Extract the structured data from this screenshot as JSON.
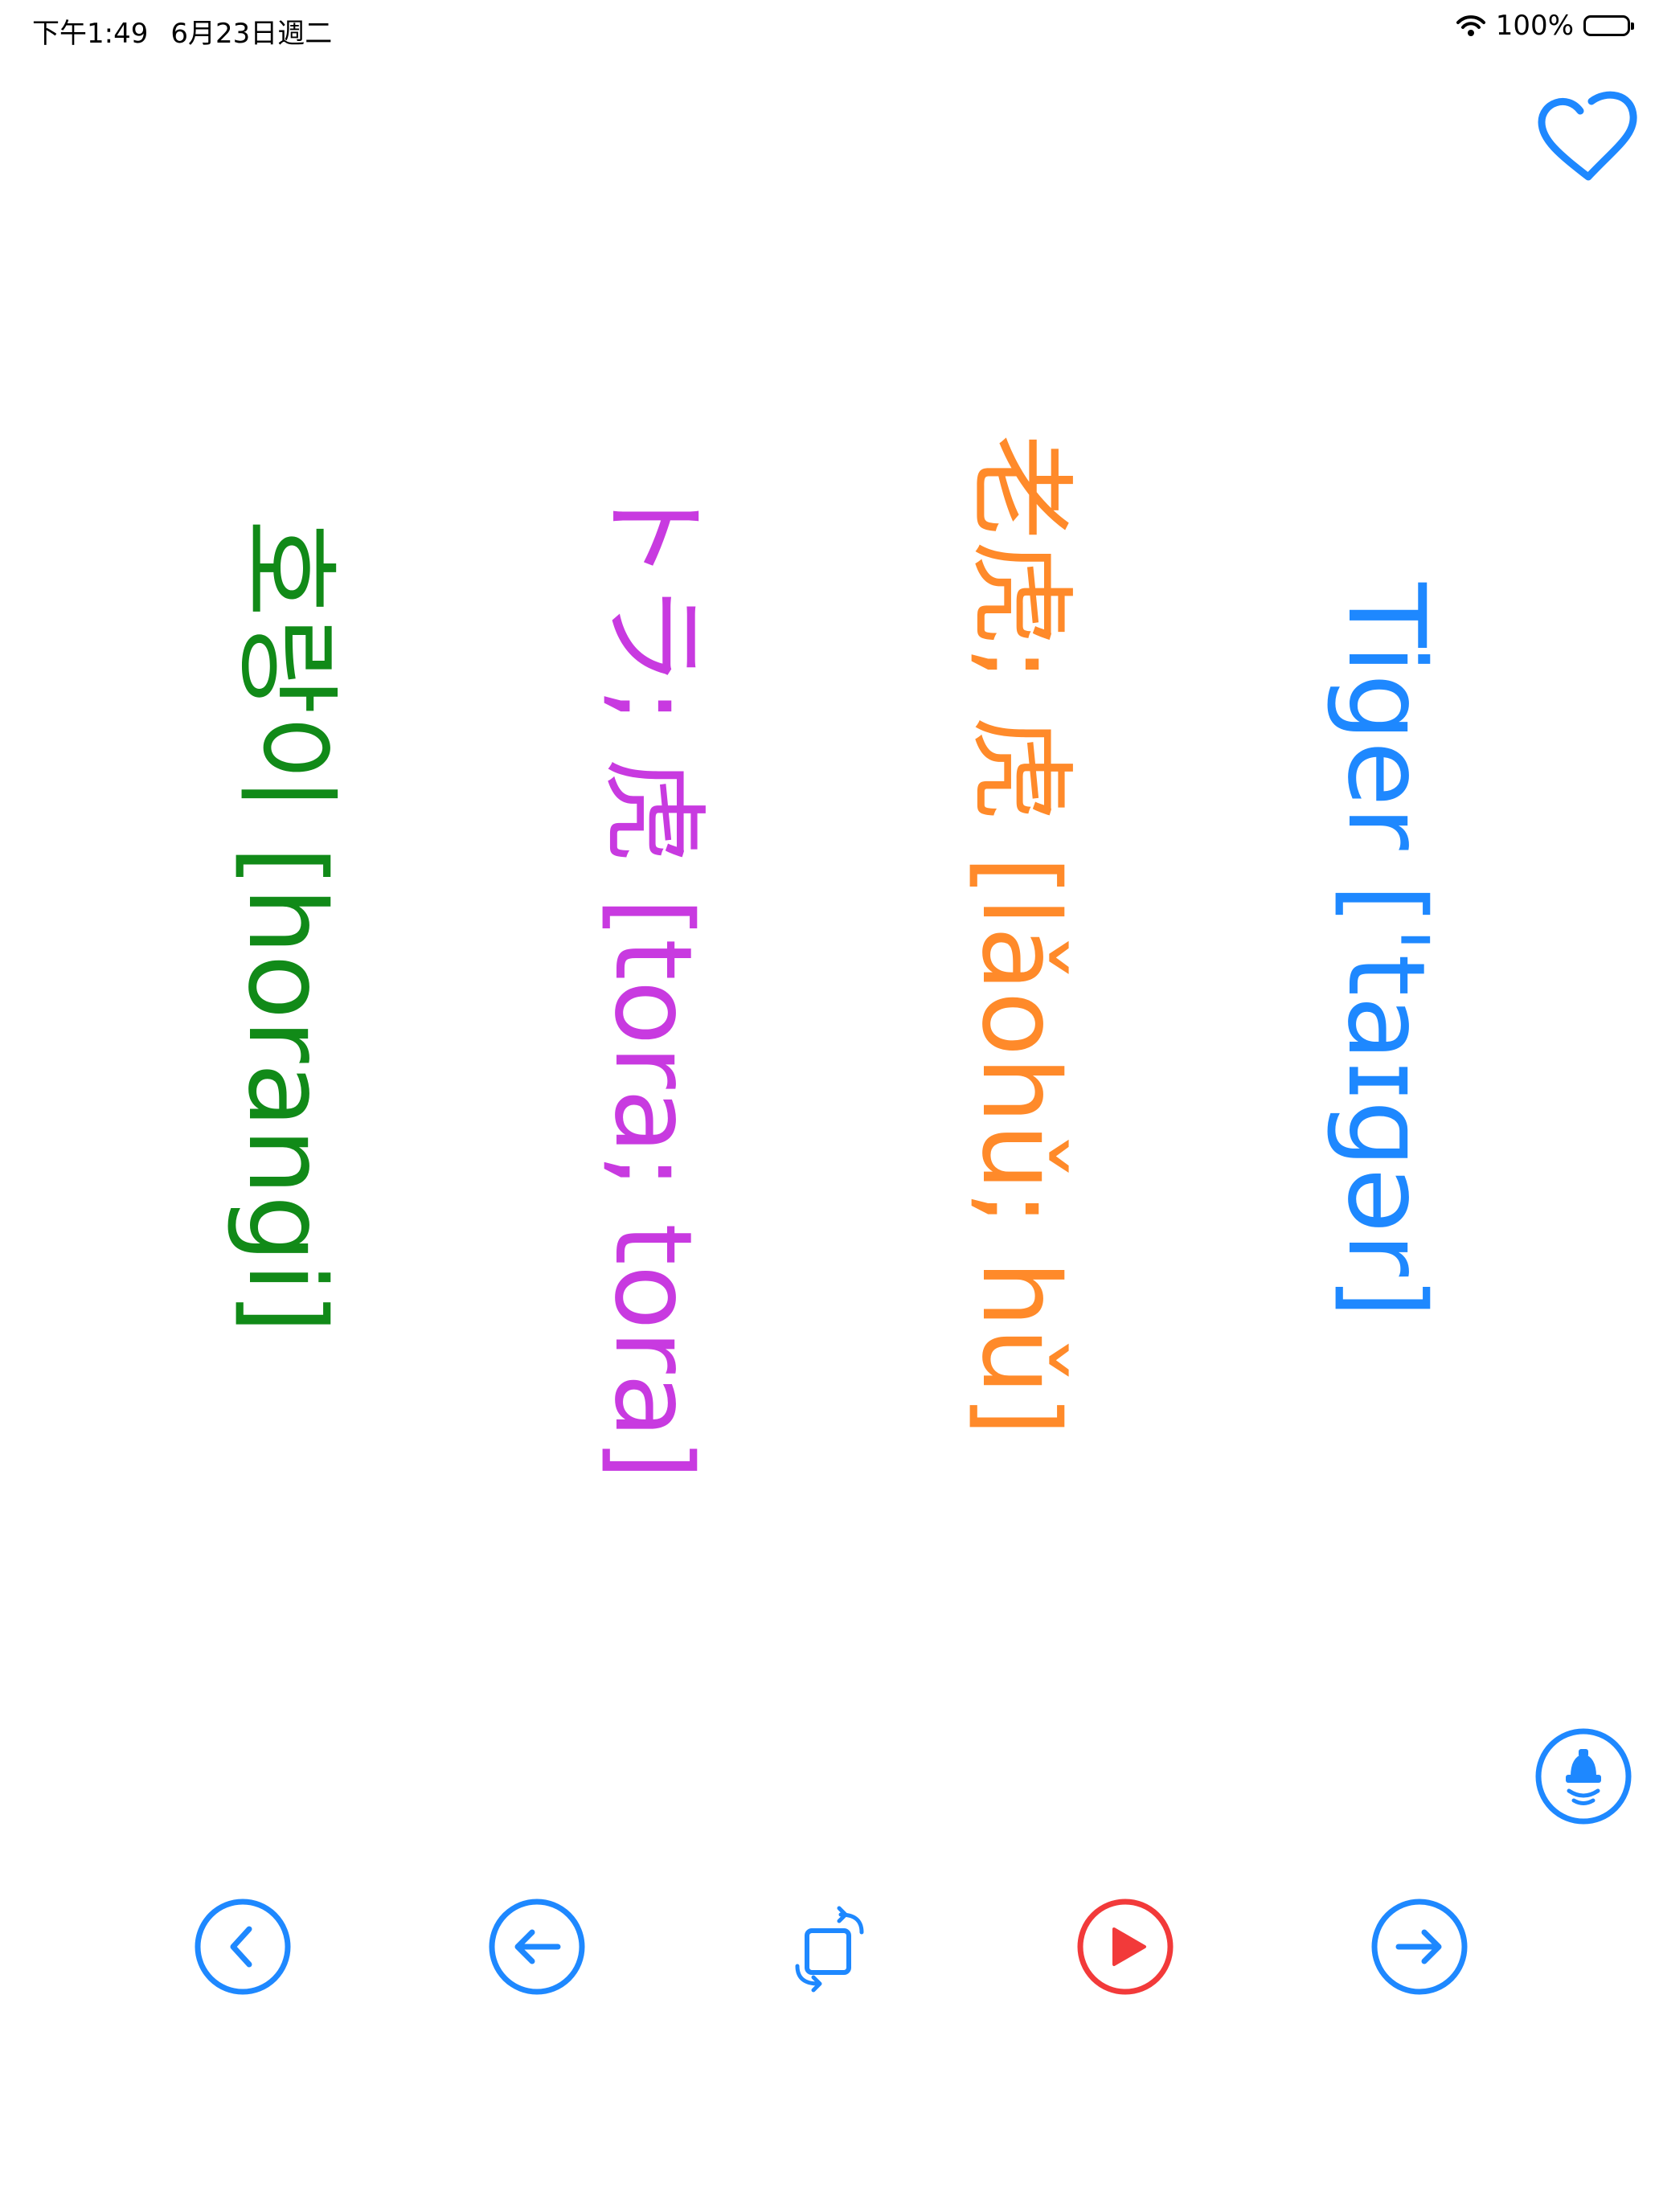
{
  "status_bar": {
    "time": "下午1:49",
    "date": "6月23日週二",
    "battery_percent": "100%",
    "battery_level": 1.0
  },
  "card": {
    "english": "Tiger [ˈtaɪɡər]",
    "chinese": "老虎; 虎 [lǎohǔ; hǔ]",
    "japanese": "トラ; 虎 [tora; tora]",
    "korean": "호랑이 [horangi]"
  },
  "colors": {
    "english": "#1e88ff",
    "chinese": "#ff8a2a",
    "japanese": "#c83ae0",
    "korean": "#118a18",
    "accent": "#1e88ff",
    "play": "#f23a3a"
  },
  "icons": {
    "favorite": "heart-icon",
    "speak": "speaker-icon",
    "previous": "chevron-left-icon",
    "back": "arrow-left-icon",
    "rotate": "rotate-icon",
    "play": "play-icon",
    "forward": "arrow-right-icon"
  }
}
